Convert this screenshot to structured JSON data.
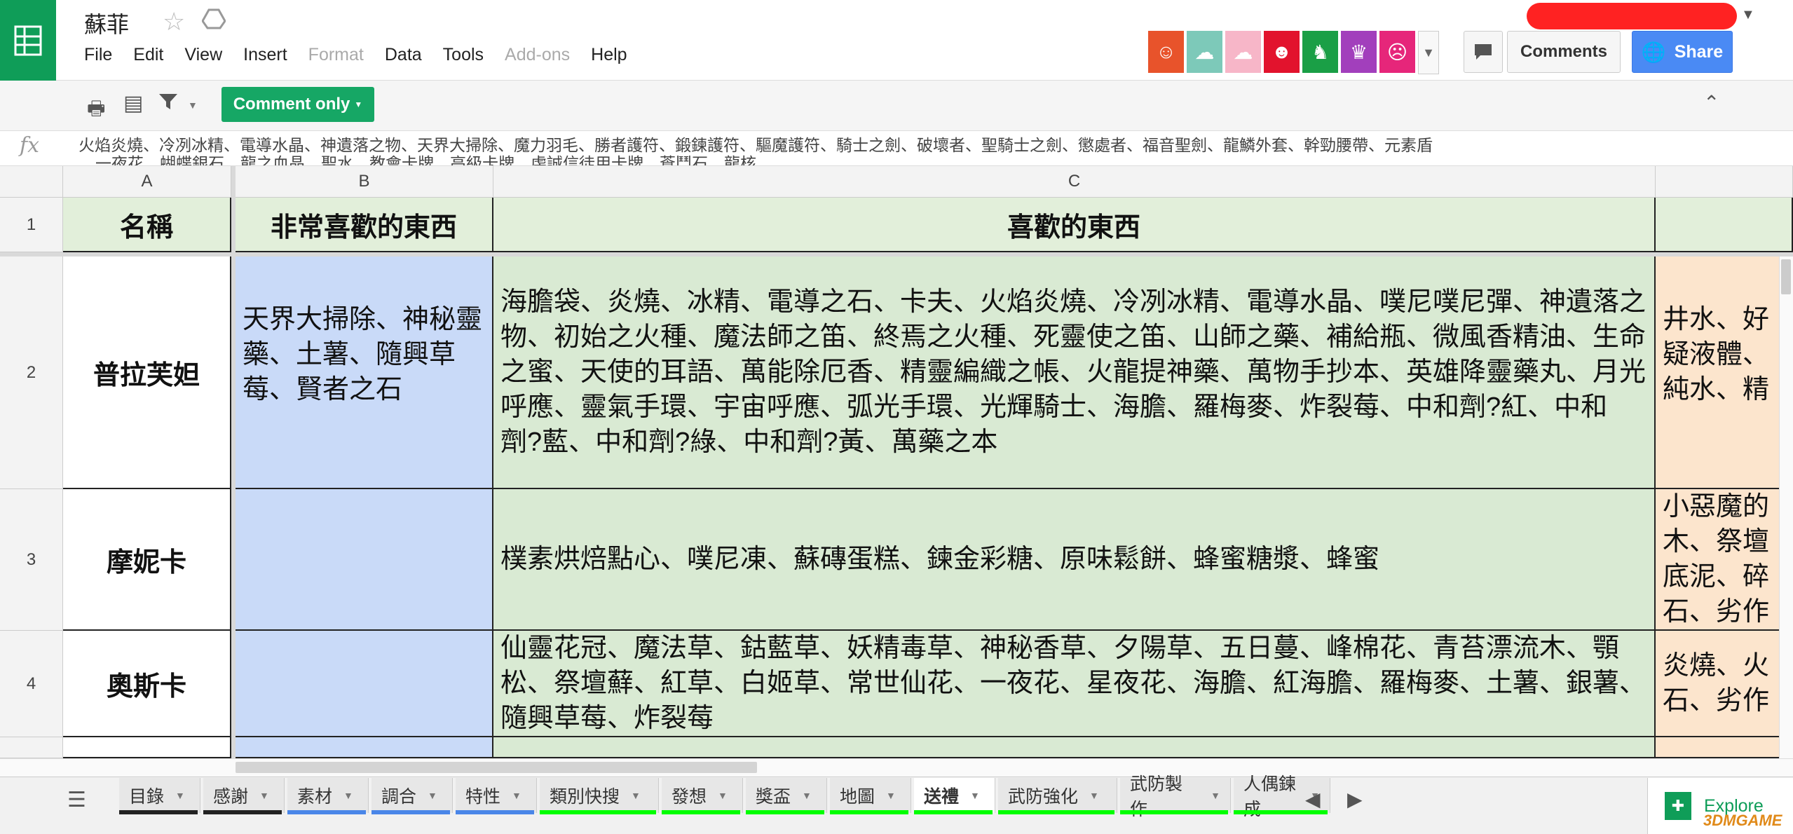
{
  "app": {
    "title": "蘇菲",
    "menus": [
      "File",
      "Edit",
      "View",
      "Insert",
      "Format",
      "Data",
      "Tools",
      "Add-ons",
      "Help"
    ],
    "disabled_menus": [
      "Format",
      "Add-ons"
    ]
  },
  "header": {
    "comments_label": "Comments",
    "share_label": "Share",
    "addon_colors": [
      "#e8532b",
      "#7dc9b9",
      "#f7b6c8",
      "#e2132d",
      "#1a9f46",
      "#a23fbc",
      "#e6267a"
    ]
  },
  "toolbar": {
    "comment_only_label": "Comment only"
  },
  "formula_bar": {
    "fx": "fx",
    "line1": "火焰炎燒、冷冽冰精、電導水晶、神遺落之物、天界大掃除、魔力羽毛、勝者護符、鍛鍊護符、驅魔護符、騎士之劍、破壞者、聖騎士之劍、懲處者、福音聖劍、龍鱗外套、幹勁腰帶、元素盾",
    "line2": "一夜花、蝴蝶銀石、龍之血晶、聖水、教會卡牌、高級卡牌、虔誠信徒用卡牌、蒼鬥石、龍核"
  },
  "grid": {
    "columns": [
      "A",
      "B",
      "C"
    ],
    "headers": {
      "a": "名稱",
      "b": "非常喜歡的東西",
      "c": "喜歡的東西"
    },
    "rows": [
      {
        "num": "2",
        "name": "普拉芙妲",
        "very_like": "天界大掃除、神秘靈藥、土薯、隨興草莓、賢者之石",
        "like": "海膽袋、炎燒、冰精、電導之石、卡夫、火焰炎燒、冷冽冰精、電導水晶、噗尼噗尼彈、神遺落之物、初始之火種、魔法師之笛、終焉之火種、死靈使之笛、山師之藥、補給瓶、微風香精油、生命之蜜、天使的耳語、萬能除厄香、精靈編織之帳、火龍提神藥、萬物手抄本、英雄降靈藥丸、月光呼應、靈氣手環、宇宙呼應、弧光手環、光輝騎士、海膽、羅梅麥、炸裂莓、中和劑?紅、中和劑?藍、中和劑?綠、中和劑?黃、萬藥之本",
        "extra": "井水、好疑液體、純水、精"
      },
      {
        "num": "3",
        "name": "摩妮卡",
        "very_like": "",
        "like": "樸素烘焙點心、噗尼凍、蘇磚蛋糕、鍊金彩糖、原味鬆餅、蜂蜜糖漿、蜂蜜",
        "extra": "小惡魔的木、祭壇底泥、碎石、劣作"
      },
      {
        "num": "4",
        "name": "奧斯卡",
        "very_like": "",
        "like": "仙靈花冠、魔法草、鈷藍草、妖精毒草、神秘香草、夕陽草、五日蔓、峰棉花、青苔漂流木、顎松、祭壇蘚、紅草、白姬草、常世仙花、一夜花、星夜花、海膽、紅海膽、羅梅麥、土薯、銀薯、隨興草莓、炸裂莓",
        "extra": "炎燒、火石、劣作"
      }
    ],
    "row_header_1": "1"
  },
  "tabs": [
    {
      "label": "目錄",
      "color": "#222222"
    },
    {
      "label": "感謝",
      "color": "#222222"
    },
    {
      "label": "素材",
      "color": "#4a86e8"
    },
    {
      "label": "調合",
      "color": "#4a86e8"
    },
    {
      "label": "特性",
      "color": "#4a86e8"
    },
    {
      "label": "類別快搜",
      "color": "#00ff00"
    },
    {
      "label": "發想",
      "color": "#00ff00"
    },
    {
      "label": "獎盃",
      "color": "#00ff00"
    },
    {
      "label": "地圖",
      "color": "#00ff00"
    },
    {
      "label": "送禮",
      "color": "#00ff00",
      "active": true
    },
    {
      "label": "武防強化",
      "color": "#00ff00"
    },
    {
      "label": "武防製作",
      "color": "#00ff00"
    },
    {
      "label": "人偶鍊成",
      "color": "#00ff00"
    }
  ],
  "explore_label": "Explore",
  "watermark": "3DMGAME",
  "colors": {
    "header_green": "#e2efda",
    "blue_cell": "#c9daf8",
    "green_cell": "#d9ead3",
    "peach_cell": "#fce5cd",
    "brand_green": "#0f9d58",
    "share_blue": "#4a8af4"
  }
}
